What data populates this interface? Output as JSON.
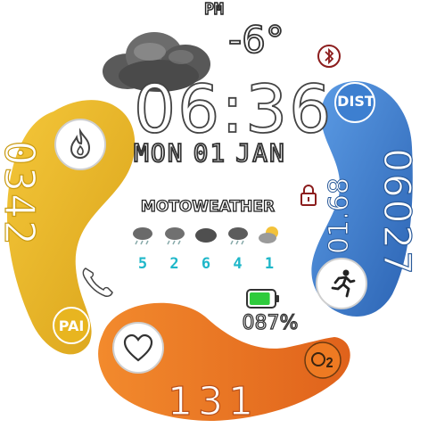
{
  "status": {
    "ampm": "PM",
    "temperature": "-6°",
    "bluetooth_icon": "bluetooth-icon",
    "lock_icon": "lock-icon"
  },
  "time": {
    "clock": "06:36",
    "weekday": "MON",
    "day": "01",
    "month": "JAN"
  },
  "weather": {
    "mode_label": "MOTOWEATHER",
    "current_icon": "cloud-icon",
    "forecast": [
      {
        "icon": "rain-cloud-icon",
        "value": "5"
      },
      {
        "icon": "rain-cloud-icon",
        "value": "2"
      },
      {
        "icon": "cloud-icon",
        "value": "6"
      },
      {
        "icon": "rain-cloud-icon",
        "value": "4"
      },
      {
        "icon": "partly-cloudy-icon",
        "value": "1"
      }
    ]
  },
  "stats": {
    "steps_left": "0342",
    "distance": "01.68",
    "distance_label": "DIST",
    "steps_right": "06027",
    "heart_rate": "131",
    "pai_label": "PAI",
    "battery_percent": "087%",
    "battery_level": 0.87
  },
  "colors": {
    "yellow": "#e8b520",
    "blue": "#3d7fd0",
    "orange": "#ee7a22",
    "forecast_text": "#1fb7c9",
    "battery_fill": "#2ecb3c",
    "accent_red": "#8c1d1d"
  },
  "icons": {
    "flame": "flame-icon",
    "runner": "runner-icon",
    "heart": "heart-icon",
    "o2": "o2-icon",
    "phone": "phone-icon",
    "battery": "battery-icon"
  }
}
